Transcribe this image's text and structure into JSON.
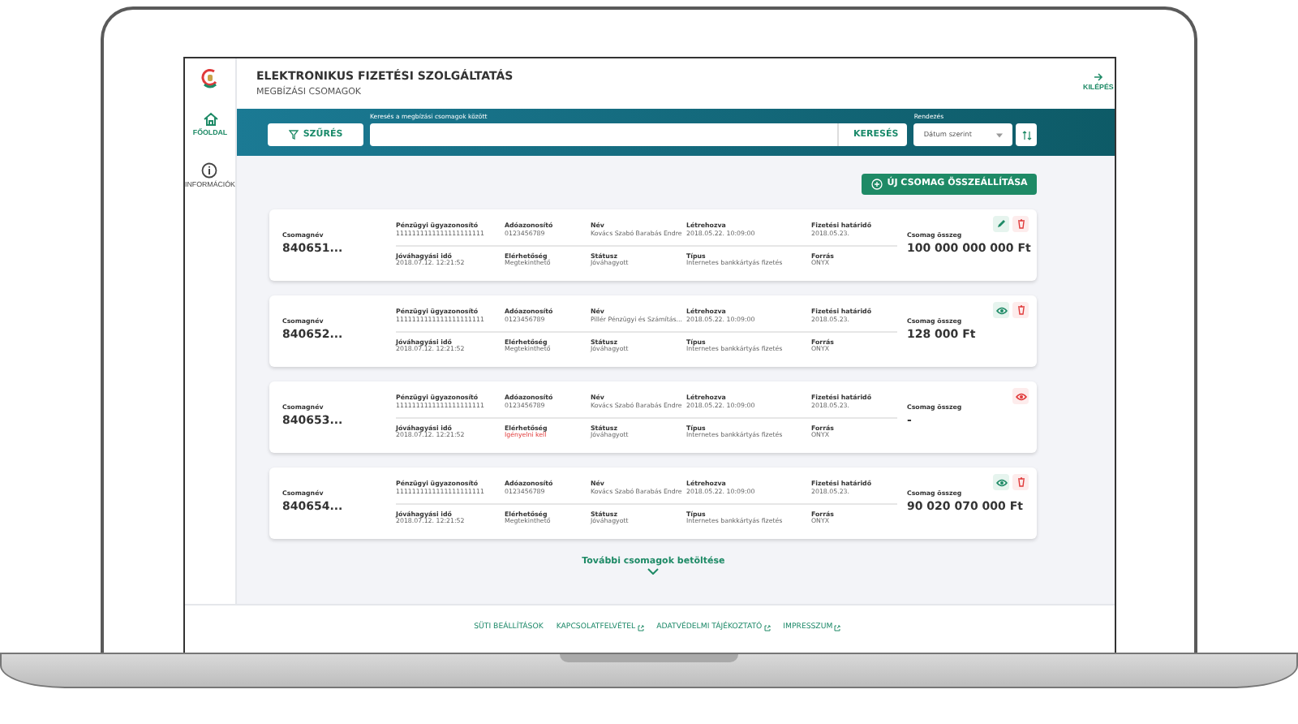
{
  "header": {
    "title": "ELEKTRONIKUS FIZETÉSI SZOLGÁLTATÁS",
    "subtitle": "MEGBÍZÁSI CSOMAGOK",
    "exit_label": "KILÉPÉS"
  },
  "sidebar": {
    "items": [
      {
        "label": "FŐOLDAL",
        "kind": "home",
        "selected": true
      },
      {
        "label": "INFORMÁCIÓK",
        "kind": "info",
        "selected": false
      }
    ]
  },
  "search_bar": {
    "filter_button": "SZŰRÉS",
    "search_label": "Keresés a megbízási csomagok között",
    "search_button": "KERESÉS",
    "sort_label": "Rendezés",
    "sort_value": "Dátum szerint"
  },
  "new_button": "ÚJ CSOMAG ÖSSZEÁLLÍTÁSA",
  "packages": [
    {
      "name_label": "Csomagnév",
      "name": "840651...",
      "access_alert": false,
      "fields": [
        [
          "Pénzügyi ügyazonosító",
          "1111111111111111111111"
        ],
        [
          "Adóazonosító",
          "0123456789"
        ],
        [
          "Név",
          "Kovács Szabó Barabás Endre"
        ],
        [
          "Létrehozva",
          "2018.05.22. 10:09:00"
        ],
        [
          "Fizetési határidő",
          "2018.05.23."
        ],
        [
          "Jóváhagyási idő",
          "2018.07.12. 12:21:52"
        ],
        [
          "Elérhetőség",
          "Megtekinthető"
        ],
        [
          "Státusz",
          "Jóváhagyott"
        ],
        [
          "Típus",
          "Internetes bankkártyás fizetés"
        ],
        [
          "Forrás",
          "ONYX"
        ]
      ],
      "total_label": "Csomag összeg",
      "total": "100 000 000 000 Ft",
      "actions": [
        {
          "kind": "edit",
          "alert": false
        },
        {
          "kind": "delete"
        }
      ]
    },
    {
      "name_label": "Csomagnév",
      "name": "840652...",
      "access_alert": false,
      "fields": [
        [
          "Pénzügyi ügyazonosító",
          "1111111111111111111111"
        ],
        [
          "Adóazonosító",
          "0123456789"
        ],
        [
          "Név",
          "Pillér Pénzügyi és Számítás..."
        ],
        [
          "Létrehozva",
          "2018.05.22. 10:09:00"
        ],
        [
          "Fizetési határidő",
          "2018.05.23."
        ],
        [
          "Jóváhagyási idő",
          "2018.07.12. 12:21:52"
        ],
        [
          "Elérhetőség",
          "Megtekinthető"
        ],
        [
          "Státusz",
          "Jóváhagyott"
        ],
        [
          "Típus",
          "Internetes bankkártyás fizetés"
        ],
        [
          "Forrás",
          "ONYX"
        ]
      ],
      "total_label": "Csomag összeg",
      "total": "128 000 Ft",
      "actions": [
        {
          "kind": "view",
          "alert": false
        },
        {
          "kind": "delete"
        }
      ]
    },
    {
      "name_label": "Csomagnév",
      "name": "840653...",
      "access_alert": true,
      "fields": [
        [
          "Pénzügyi ügyazonosító",
          "1111111111111111111111"
        ],
        [
          "Adóazonosító",
          "0123456789"
        ],
        [
          "Név",
          "Kovács Szabó Barabás Endre"
        ],
        [
          "Létrehozva",
          "2018.05.22. 10:09:00"
        ],
        [
          "Fizetési határidő",
          "2018.05.23."
        ],
        [
          "Jóváhagyási idő",
          "2018.07.12. 12:21:52"
        ],
        [
          "Elérhetőség",
          "Igényelni kell"
        ],
        [
          "Státusz",
          "Jóváhagyott"
        ],
        [
          "Típus",
          "Internetes bankkártyás fizetés"
        ],
        [
          "Forrás",
          "ONYX"
        ]
      ],
      "total_label": "Csomag összeg",
      "total": "-",
      "actions": [
        {
          "kind": "view",
          "alert": true
        }
      ]
    },
    {
      "name_label": "Csomagnév",
      "name": "840654...",
      "access_alert": false,
      "fields": [
        [
          "Pénzügyi ügyazonosító",
          "1111111111111111111111"
        ],
        [
          "Adóazonosító",
          "0123456789"
        ],
        [
          "Név",
          "Kovács Szabó Barabás Endre"
        ],
        [
          "Létrehozva",
          "2018.05.22. 10:09:00"
        ],
        [
          "Fizetési határidő",
          "2018.05.23."
        ],
        [
          "Jóváhagyási idő",
          "2018.07.12. 12:21:52"
        ],
        [
          "Elérhetőség",
          "Megtekinthető"
        ],
        [
          "Státusz",
          "Jóváhagyott"
        ],
        [
          "Típus",
          "Internetes bankkártyás fizetés"
        ],
        [
          "Forrás",
          "ONYX"
        ]
      ],
      "total_label": "Csomag összeg",
      "total": "90 020 070 000 Ft",
      "actions": [
        {
          "kind": "view",
          "alert": false
        },
        {
          "kind": "delete"
        }
      ]
    }
  ],
  "load_more": "További csomagok betöltése",
  "footer_links": [
    {
      "label": "SÜTI BEÁLLÍTÁSOK",
      "external": false
    },
    {
      "label": "KAPCSOLATFELVÉTEL",
      "external": true
    },
    {
      "label": "ADATVÉDELMI TÁJÉKOZTATÓ",
      "external": true
    },
    {
      "label": "IMPRESSZUM",
      "external": true
    }
  ]
}
